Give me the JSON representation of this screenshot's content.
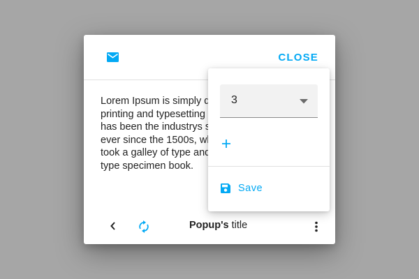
{
  "dialog": {
    "close_label": "CLOSE",
    "body_text": "Lorem Ipsum is simply dummy text of the printing and typesetting industry. Lorem Ipsum has been the industrys standard dummy text ever since the 1500s, when an unknown printer took a galley of type and scrambled it to make a type specimen book.",
    "footer": {
      "title_bold": "Popup's",
      "title_rest": " title"
    }
  },
  "menu": {
    "select_value": "3",
    "save_label": "Save"
  },
  "icons": {
    "header": "mail-icon",
    "footer": [
      "chevron-left-icon",
      "sync-icon",
      "more-vert-icon"
    ],
    "menu": [
      "arrow-drop-down-icon",
      "add-icon",
      "save-icon"
    ]
  },
  "colors": {
    "accent": "#03a9f4",
    "text": "#222222",
    "backdrop": "#a6a6a6",
    "field_bg": "#f2f2f2"
  }
}
